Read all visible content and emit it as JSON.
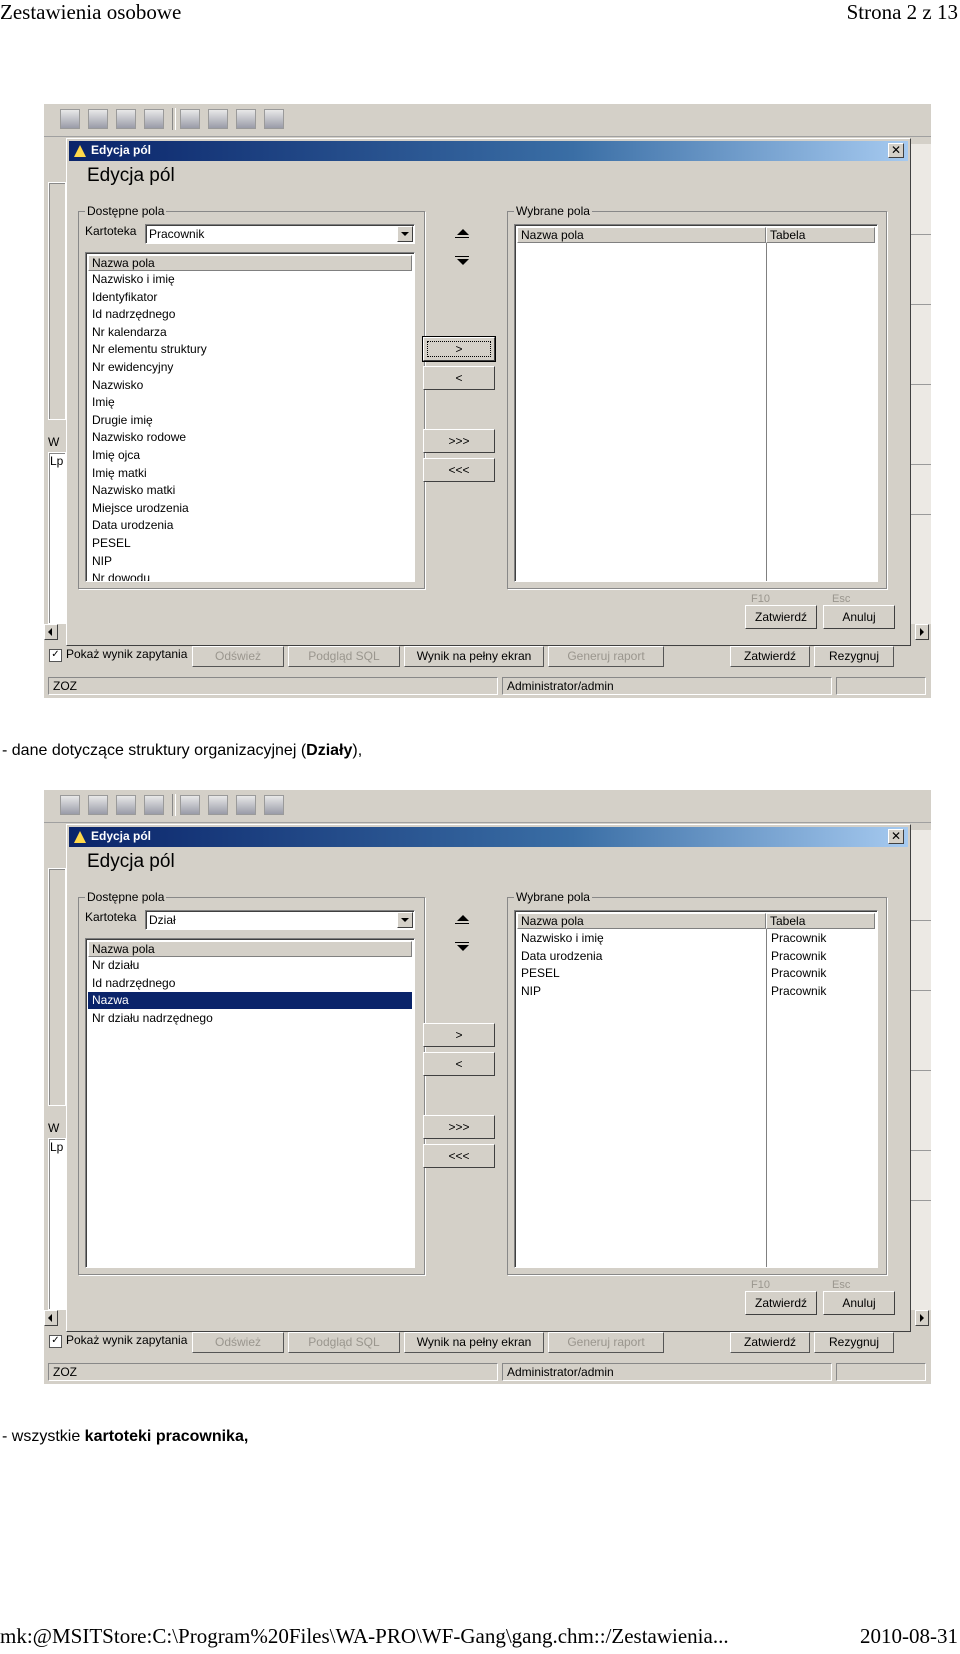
{
  "page_header": {
    "title": "Zestawienia osobowe",
    "page": "Strona 2 z 13"
  },
  "page_footer": {
    "path": "mk:@MSITStore:C:\\Program%20Files\\WA-PRO\\WF-Gang\\gang.chm::/Zestawienia...",
    "date": "2010-08-31"
  },
  "caption1": {
    "prefix": "- dane dotyczące struktury organizacyjnej (",
    "bold": "Działy",
    "suffix": "),"
  },
  "caption2": {
    "prefix": "- wszystkie ",
    "bold": "kartoteki pracownika,"
  },
  "app": {
    "bottom_bar": {
      "checkbox_label": "Pokaż wynik zapytania",
      "refresh": "Odśwież",
      "sql_preview": "Podgląd SQL",
      "fullscreen": "Wynik na pełny ekran",
      "generate": "Generuj raport",
      "ok": "Zatwierdź",
      "cancel": "Rezygnuj"
    },
    "status": {
      "left": "ZOZ",
      "user": "Administrator/admin"
    },
    "bg_letters": {
      "w": "W",
      "lp": "Lp"
    }
  },
  "dialog": {
    "title": "Edycja pól",
    "heading": "Edycja pól",
    "available_group": "Dostępne pola",
    "selected_group": "Wybrane pola",
    "kartoteka_label": "Kartoteka",
    "col_field": "Nazwa pola",
    "col_table": "Tabela",
    "btn_add": ">",
    "btn_remove": "<",
    "btn_add_all": ">>>",
    "btn_remove_all": "<<<",
    "f10": "F10",
    "esc": "Esc",
    "ok": "Zatwierdź",
    "cancel": "Anuluj"
  },
  "shot1": {
    "kartoteka": "Pracownik",
    "available": [
      "Nazwisko i imię",
      "Identyfikator",
      "Id nadrzędnego",
      "Nr kalendarza",
      "Nr elementu struktury",
      "Nr ewidencyjny",
      "Nazwisko",
      "Imię",
      "Drugie imię",
      "Nazwisko rodowe",
      "Imię ojca",
      "Imię matki",
      "Nazwisko matki",
      "Miejsce urodzenia",
      "Data urodzenia",
      "PESEL",
      "NIP",
      "Nr dowodu"
    ],
    "selected": []
  },
  "shot2": {
    "kartoteka": "Dział",
    "available": [
      "Nr działu",
      "Id nadrzędnego",
      "Nazwa",
      "Nr działu nadrzędnego"
    ],
    "selected_index": 2,
    "selected": [
      {
        "field": "Nazwisko i imię",
        "table": "Pracownik"
      },
      {
        "field": "Data urodzenia",
        "table": "Pracownik"
      },
      {
        "field": "PESEL",
        "table": "Pracownik"
      },
      {
        "field": "NIP",
        "table": "Pracownik"
      }
    ]
  }
}
